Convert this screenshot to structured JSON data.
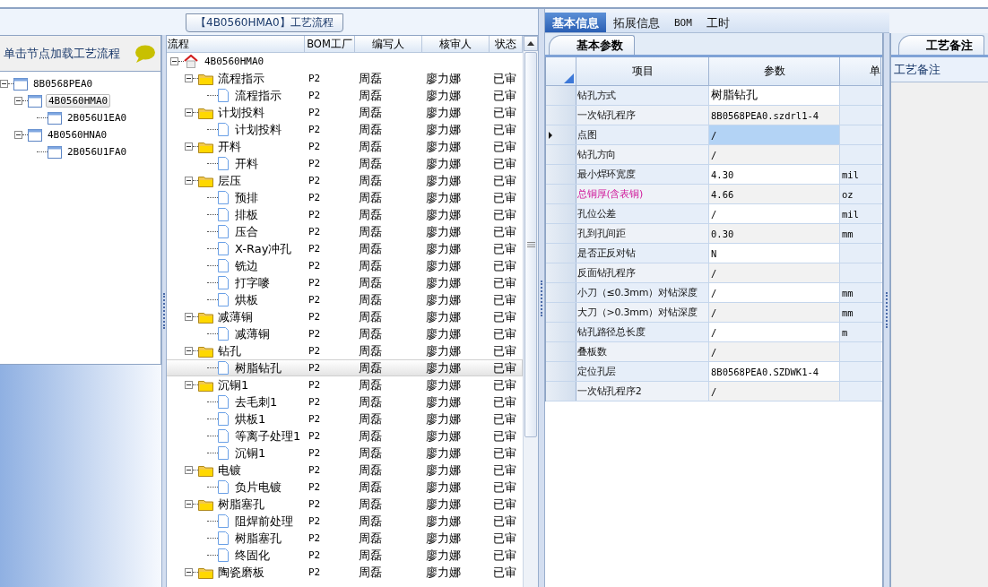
{
  "process_title": "【4B0560HMA0】工艺流程",
  "left_panel": {
    "hint": "单击节点加载工艺流程",
    "tree": [
      {
        "label": "8B0568PEA0",
        "expanded": true,
        "selected": false,
        "children": [
          {
            "label": "4B0560HMA0",
            "expanded": true,
            "selected": true,
            "children": [
              {
                "label": "2B056U1EA0",
                "selected": false
              }
            ]
          },
          {
            "label": "4B0560HNA0",
            "expanded": true,
            "selected": false,
            "children": [
              {
                "label": "2B056U1FA0",
                "selected": false
              }
            ]
          }
        ]
      }
    ]
  },
  "process_grid": {
    "columns": [
      "流程",
      "BOM工厂",
      "编写人",
      "核审人",
      "状态"
    ],
    "root": {
      "label": "4B0560HMA0",
      "expanded": true,
      "children": [
        {
          "label": "流程指示",
          "kind": "folder",
          "expanded": true,
          "selected": false,
          "bom": "P2",
          "writer": "周磊",
          "reviewer": "廖力娜",
          "status": "已审",
          "children": [
            {
              "label": "流程指示",
              "kind": "step",
              "selected": false,
              "bom": "P2",
              "writer": "周磊",
              "reviewer": "廖力娜",
              "status": "已审"
            }
          ]
        },
        {
          "label": "计划投料",
          "kind": "folder",
          "expanded": true,
          "selected": false,
          "bom": "P2",
          "writer": "周磊",
          "reviewer": "廖力娜",
          "status": "已审",
          "children": [
            {
              "label": "计划投料",
              "kind": "step",
              "selected": false,
              "bom": "P2",
              "writer": "周磊",
              "reviewer": "廖力娜",
              "status": "已审"
            }
          ]
        },
        {
          "label": "开料",
          "kind": "folder",
          "expanded": true,
          "selected": false,
          "bom": "P2",
          "writer": "周磊",
          "reviewer": "廖力娜",
          "status": "已审",
          "children": [
            {
              "label": "开料",
              "kind": "step",
              "selected": false,
              "bom": "P2",
              "writer": "周磊",
              "reviewer": "廖力娜",
              "status": "已审"
            }
          ]
        },
        {
          "label": "层压",
          "kind": "folder",
          "expanded": true,
          "selected": false,
          "bom": "P2",
          "writer": "周磊",
          "reviewer": "廖力娜",
          "status": "已审",
          "children": [
            {
              "label": "预排",
              "kind": "step",
              "selected": false,
              "bom": "P2",
              "writer": "周磊",
              "reviewer": "廖力娜",
              "status": "已审"
            },
            {
              "label": "排板",
              "kind": "step",
              "selected": false,
              "bom": "P2",
              "writer": "周磊",
              "reviewer": "廖力娜",
              "status": "已审"
            },
            {
              "label": "压合",
              "kind": "step",
              "selected": false,
              "bom": "P2",
              "writer": "周磊",
              "reviewer": "廖力娜",
              "status": "已审"
            },
            {
              "label": "X-Ray冲孔",
              "kind": "step",
              "selected": false,
              "bom": "P2",
              "writer": "周磊",
              "reviewer": "廖力娜",
              "status": "已审"
            },
            {
              "label": "铣边",
              "kind": "step",
              "selected": false,
              "bom": "P2",
              "writer": "周磊",
              "reviewer": "廖力娜",
              "status": "已审"
            },
            {
              "label": "打字嘜",
              "kind": "step",
              "selected": false,
              "bom": "P2",
              "writer": "周磊",
              "reviewer": "廖力娜",
              "status": "已审"
            },
            {
              "label": "烘板",
              "kind": "step",
              "selected": false,
              "bom": "P2",
              "writer": "周磊",
              "reviewer": "廖力娜",
              "status": "已审"
            }
          ]
        },
        {
          "label": "减薄铜",
          "kind": "folder",
          "expanded": true,
          "selected": false,
          "bom": "P2",
          "writer": "周磊",
          "reviewer": "廖力娜",
          "status": "已审",
          "children": [
            {
              "label": "减薄铜",
              "kind": "step",
              "selected": false,
              "bom": "P2",
              "writer": "周磊",
              "reviewer": "廖力娜",
              "status": "已审"
            }
          ]
        },
        {
          "label": "钻孔",
          "kind": "folder",
          "expanded": true,
          "selected": false,
          "bom": "P2",
          "writer": "周磊",
          "reviewer": "廖力娜",
          "status": "已审",
          "children": [
            {
              "label": "树脂钻孔",
              "kind": "step",
              "selected": true,
              "bom": "P2",
              "writer": "周磊",
              "reviewer": "廖力娜",
              "status": "已审"
            }
          ]
        },
        {
          "label": "沉铜1",
          "kind": "folder",
          "expanded": true,
          "selected": false,
          "bom": "P2",
          "writer": "周磊",
          "reviewer": "廖力娜",
          "status": "已审",
          "children": [
            {
              "label": "去毛刺1",
              "kind": "step",
              "selected": false,
              "bom": "P2",
              "writer": "周磊",
              "reviewer": "廖力娜",
              "status": "已审"
            },
            {
              "label": "烘板1",
              "kind": "step",
              "selected": false,
              "bom": "P2",
              "writer": "周磊",
              "reviewer": "廖力娜",
              "status": "已审"
            },
            {
              "label": "等离子处理1",
              "kind": "step",
              "selected": false,
              "bom": "P2",
              "writer": "周磊",
              "reviewer": "廖力娜",
              "status": "已审"
            },
            {
              "label": "沉铜1",
              "kind": "step",
              "selected": false,
              "bom": "P2",
              "writer": "周磊",
              "reviewer": "廖力娜",
              "status": "已审"
            }
          ]
        },
        {
          "label": "电镀",
          "kind": "folder",
          "expanded": true,
          "selected": false,
          "bom": "P2",
          "writer": "周磊",
          "reviewer": "廖力娜",
          "status": "已审",
          "children": [
            {
              "label": "负片电镀",
              "kind": "step",
              "selected": false,
              "bom": "P2",
              "writer": "周磊",
              "reviewer": "廖力娜",
              "status": "已审"
            }
          ]
        },
        {
          "label": "树脂塞孔",
          "kind": "folder",
          "expanded": true,
          "selected": false,
          "bom": "P2",
          "writer": "周磊",
          "reviewer": "廖力娜",
          "status": "已审",
          "children": [
            {
              "label": "阻焊前处理",
              "kind": "step",
              "selected": false,
              "bom": "P2",
              "writer": "周磊",
              "reviewer": "廖力娜",
              "status": "已审"
            },
            {
              "label": "树脂塞孔",
              "kind": "step",
              "selected": false,
              "bom": "P2",
              "writer": "周磊",
              "reviewer": "廖力娜",
              "status": "已审"
            },
            {
              "label": "终固化",
              "kind": "step",
              "selected": false,
              "bom": "P2",
              "writer": "周磊",
              "reviewer": "廖力娜",
              "status": "已审"
            }
          ]
        },
        {
          "label": "陶瓷磨板",
          "kind": "folder",
          "expanded": true,
          "selected": false,
          "bom": "P2",
          "writer": "周磊",
          "reviewer": "廖力娜",
          "status": "已审"
        }
      ]
    }
  },
  "detail_tabs": [
    {
      "label": "基本信息",
      "selected": true
    },
    {
      "label": "拓展信息",
      "selected": false
    },
    {
      "label": "BOM",
      "selected": false
    },
    {
      "label": "工时",
      "selected": false
    }
  ],
  "params_panel": {
    "tab": "基本参数",
    "columns": [
      "项目",
      "参数",
      "单"
    ],
    "rows": [
      {
        "item": "钻孔方式",
        "value": "树脂钻孔",
        "selected": false,
        "highlighted": false
      },
      {
        "item": "一次钻孔程序",
        "value": "8B0568PEA0.szdrl1-4",
        "selected": false,
        "highlighted": false
      },
      {
        "item": "点图",
        "value": "/",
        "selected": true,
        "highlighted": false
      },
      {
        "item": "钻孔方向",
        "value": "/",
        "selected": false,
        "highlighted": false
      },
      {
        "item": "最小焊环宽度",
        "value": "4.30",
        "unit": "mil",
        "selected": false,
        "highlighted": false
      },
      {
        "item": "总铜厚(含表铜)",
        "value": "4.66",
        "unit": "oz",
        "selected": false,
        "highlighted": true
      },
      {
        "item": "孔位公差",
        "value": "/",
        "unit": "mil",
        "selected": false,
        "highlighted": false
      },
      {
        "item": "孔到孔间距",
        "value": "0.30",
        "unit": "mm",
        "selected": false,
        "highlighted": false
      },
      {
        "item": "是否正反对钻",
        "value": "N",
        "selected": false,
        "highlighted": false
      },
      {
        "item": "反面钻孔程序",
        "value": "/",
        "selected": false,
        "highlighted": false
      },
      {
        "item": "小刀（≤0.3mm）对钻深度",
        "value": "/",
        "unit": "mm",
        "selected": false,
        "highlighted": false
      },
      {
        "item": "大刀（>0.3mm）对钻深度",
        "value": "/",
        "unit": "mm",
        "selected": false,
        "highlighted": false
      },
      {
        "item": "钻孔路径总长度",
        "value": "/",
        "unit": "m",
        "selected": false,
        "highlighted": false
      },
      {
        "item": "叠板数",
        "value": "/",
        "selected": false,
        "highlighted": false
      },
      {
        "item": "定位孔层",
        "value": "8B0568PEA0.SZDWK1-4",
        "selected": false,
        "highlighted": false
      },
      {
        "item": "一次钻孔程序2",
        "value": "/",
        "selected": false,
        "highlighted": false
      }
    ]
  },
  "remarks_panel": {
    "tab": "工艺备注",
    "label": "工艺备注"
  }
}
